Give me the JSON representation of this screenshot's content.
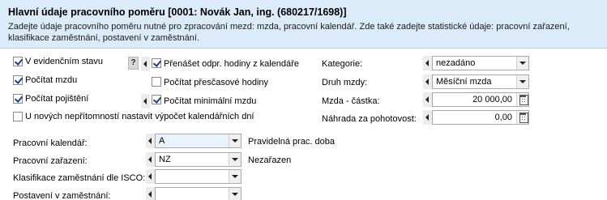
{
  "header": {
    "title": "Hlavní údaje pracovního poměru [0001: Novák Jan, ing. (680217/1698)]",
    "description": "Zadejte údaje pracovního poměru nutné pro zpracování mezd: mzda, pracovní kalendář. Zde také zadejte statistické údaje: pracovní zařazení, klasifikace zaměstnání, postavení v zaměstnání."
  },
  "checkboxes": {
    "v_evidencnim_stavu": {
      "label": "V evidenčním stavu",
      "checked": true
    },
    "pocitat_mzdu": {
      "label": "Počítat mzdu",
      "checked": true
    },
    "pocitat_pojisteni": {
      "label": "Počítat pojištění",
      "checked": true
    },
    "prenaset_hodiny": {
      "label": "Přenášet odpr. hodiny z kalendáře",
      "checked": true
    },
    "pocitat_prescasove": {
      "label": "Počítat přesčasové hodiny",
      "checked": false
    },
    "pocitat_minimalni": {
      "label": "Počítat minimální mzdu",
      "checked": true
    },
    "neprimnosti": {
      "label": "U nových nepřítomností nastavit výpočet kalendářních dní",
      "checked": false
    }
  },
  "help_button": "?",
  "right_fields": {
    "kategorie": {
      "label": "Kategorie:",
      "value": "nezadáno"
    },
    "druh_mzdy": {
      "label": "Druh mzdy:",
      "value": "Měsíční mzda"
    },
    "mzda_castka": {
      "label": "Mzda - částka:",
      "value": "20 000,00"
    },
    "nahrada": {
      "label": "Náhrada za pohotovost:",
      "value": "0,00"
    }
  },
  "bottom_fields": {
    "kalendar": {
      "label": "Pracovní kalendář:",
      "value": "A",
      "note": "Pravidelná prac. doba"
    },
    "zarazeni": {
      "label": "Pracovní zařazení:",
      "value": "NZ",
      "note": "Nezařazen"
    },
    "isco": {
      "label": "Klasifikace zaměstnání dle ISCO:",
      "value": ""
    },
    "postaveni": {
      "label": "Postavení v zaměstnání:",
      "value": ""
    }
  }
}
